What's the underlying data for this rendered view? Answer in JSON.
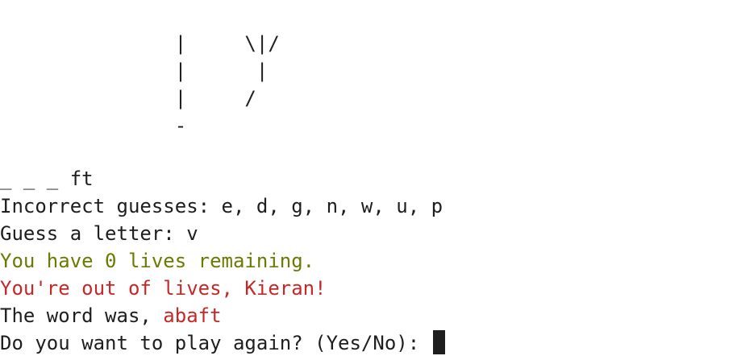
{
  "hangman_art": [
    "               |     \\|/",
    "               |      |",
    "               |     /",
    "               -"
  ],
  "word_progress": "_ _ _ ft",
  "incorrect_guesses": "Incorrect guesses: e, d, g, n, w, u, p",
  "guess_prompt": "Guess a letter: v",
  "lives_message": "You have 0 lives remaining.",
  "out_of_lives_message": "You're out of lives, Kieran!",
  "word_reveal_prefix": "The word was, ",
  "word_reveal_word": "abaft",
  "play_again_prompt": "Do you want to play again? (Yes/No): ",
  "colors": {
    "text": "#1e1e1e",
    "lives_message": "#6b7a00",
    "error_message": "#c62828"
  }
}
